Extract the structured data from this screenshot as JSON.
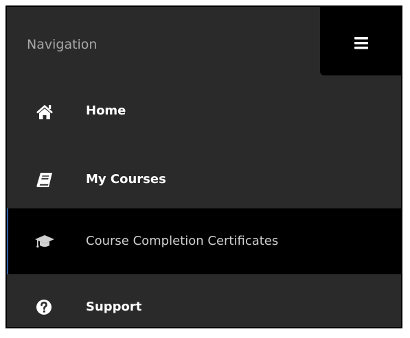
{
  "nav": {
    "title": "Navigation",
    "toggle_icon": "hamburger-menu-icon",
    "items": [
      {
        "label": "Home",
        "icon": "home-icon",
        "active": false
      },
      {
        "label": "My Courses",
        "icon": "book-icon",
        "active": false
      },
      {
        "label": "Course Completion Certificates",
        "icon": "graduation-cap-icon",
        "active": true
      },
      {
        "label": "Support",
        "icon": "question-circle-icon",
        "active": false
      }
    ]
  },
  "colors": {
    "panel_bg": "#2a2a2a",
    "active_bg": "#000000",
    "active_border": "#2d5fa6",
    "title_text": "#a8a8a8",
    "item_text": "#ffffff"
  }
}
